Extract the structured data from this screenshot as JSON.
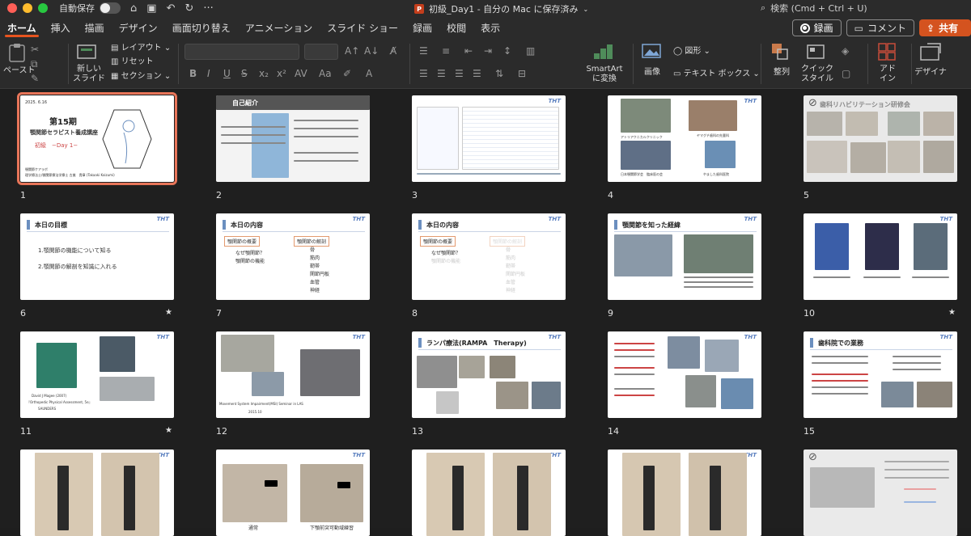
{
  "titlebar": {
    "autosave_label": "自動保存",
    "doc_title": "初級_Day1 - 自分の Mac に保存済み",
    "ppt_badge": "P",
    "search_placeholder": "検索 (Cmd + Ctrl + U)"
  },
  "tabs": [
    {
      "label": "ホーム",
      "active": true
    },
    {
      "label": "挿入"
    },
    {
      "label": "描画"
    },
    {
      "label": "デザイン"
    },
    {
      "label": "画面切り替え"
    },
    {
      "label": "アニメーション"
    },
    {
      "label": "スライド ショー"
    },
    {
      "label": "録画"
    },
    {
      "label": "校閲"
    },
    {
      "label": "表示"
    }
  ],
  "actions": {
    "record": "録画",
    "comment": "コメント",
    "share": "共有"
  },
  "ribbon": {
    "paste": "ペースト",
    "new_slide": "新しい\nスライド",
    "layout": "レイアウト",
    "reset": "リセット",
    "section": "セクション",
    "smartart": "SmartArt\nに変換",
    "picture": "画像",
    "shape": "図形",
    "textbox": "テキスト ボックス",
    "arrange": "整列",
    "quick_style": "クイック\nスタイル",
    "addin": "アド\nイン",
    "designer": "デザイナ"
  },
  "slides": [
    {
      "num": "1",
      "title": "第15期",
      "sub": "顎関節セラピスト養成講座",
      "sub2": "初級　−Day 1−",
      "date": "2025. 6.16",
      "footer": "顎関節ケアラボ",
      "footer2": "理学療法士/顎関節療法学療士 古美　貴章 (Takaaki Koizumi)"
    },
    {
      "num": "2",
      "title": "自己紹介"
    },
    {
      "num": "3"
    },
    {
      "num": "4",
      "cap1": "アトリアクニカルクリニック",
      "cap2": "日本顎関節学会　臨床医の会",
      "cap3": "ヤマグチ歯科の先輩科",
      "cap4": "やました歯科医院"
    },
    {
      "num": "5",
      "title": "歯科リハビリテーション研修会"
    },
    {
      "num": "6",
      "title": "本日の目標",
      "item1": "1.顎関節の機能について知る",
      "item2": "2.顎関節の解剖を知識に入れる",
      "star": "★"
    },
    {
      "num": "7",
      "title": "本日の内容",
      "box1": "顎関節の概要",
      "box2": "顎関節の解剖",
      "l1": "なぜ顎関節？",
      "l2": "顎関節の機能",
      "r1": "骨",
      "r2": "筋肉",
      "r3": "靭帯",
      "r4": "関節円板",
      "r5": "血管",
      "r6": "神経"
    },
    {
      "num": "8",
      "title": "本日の内容",
      "box1": "顎関節の概要",
      "box2": "顎関節の解剖",
      "l1": "なぜ顎関節？",
      "l2": "顎関節の機能",
      "r1": "骨",
      "r2": "筋肉",
      "r3": "靭帯",
      "r4": "関節円板",
      "r5": "血管",
      "r6": "神経"
    },
    {
      "num": "9",
      "title": "顎関節を知った経緯"
    },
    {
      "num": "10",
      "star": "★"
    },
    {
      "num": "11",
      "cap": "David J Magee (2007)",
      "cap2": "『Orthopedic Physical Assessment, 5e』",
      "cap3": "SAUNDERS",
      "star": "★"
    },
    {
      "num": "12",
      "cap": "Movement System Impairment(MSI) Seminar in LAS",
      "cap2": "2015.10"
    },
    {
      "num": "13",
      "title": "ランパ療法(RAMPA　Therapy)"
    },
    {
      "num": "14"
    },
    {
      "num": "15",
      "title": "歯科院での業務"
    },
    {
      "num": ""
    },
    {
      "num": "",
      "cap1": "通常",
      "cap2": "下顎前突可動域練習"
    },
    {
      "num": ""
    },
    {
      "num": ""
    },
    {
      "num": ""
    }
  ]
}
